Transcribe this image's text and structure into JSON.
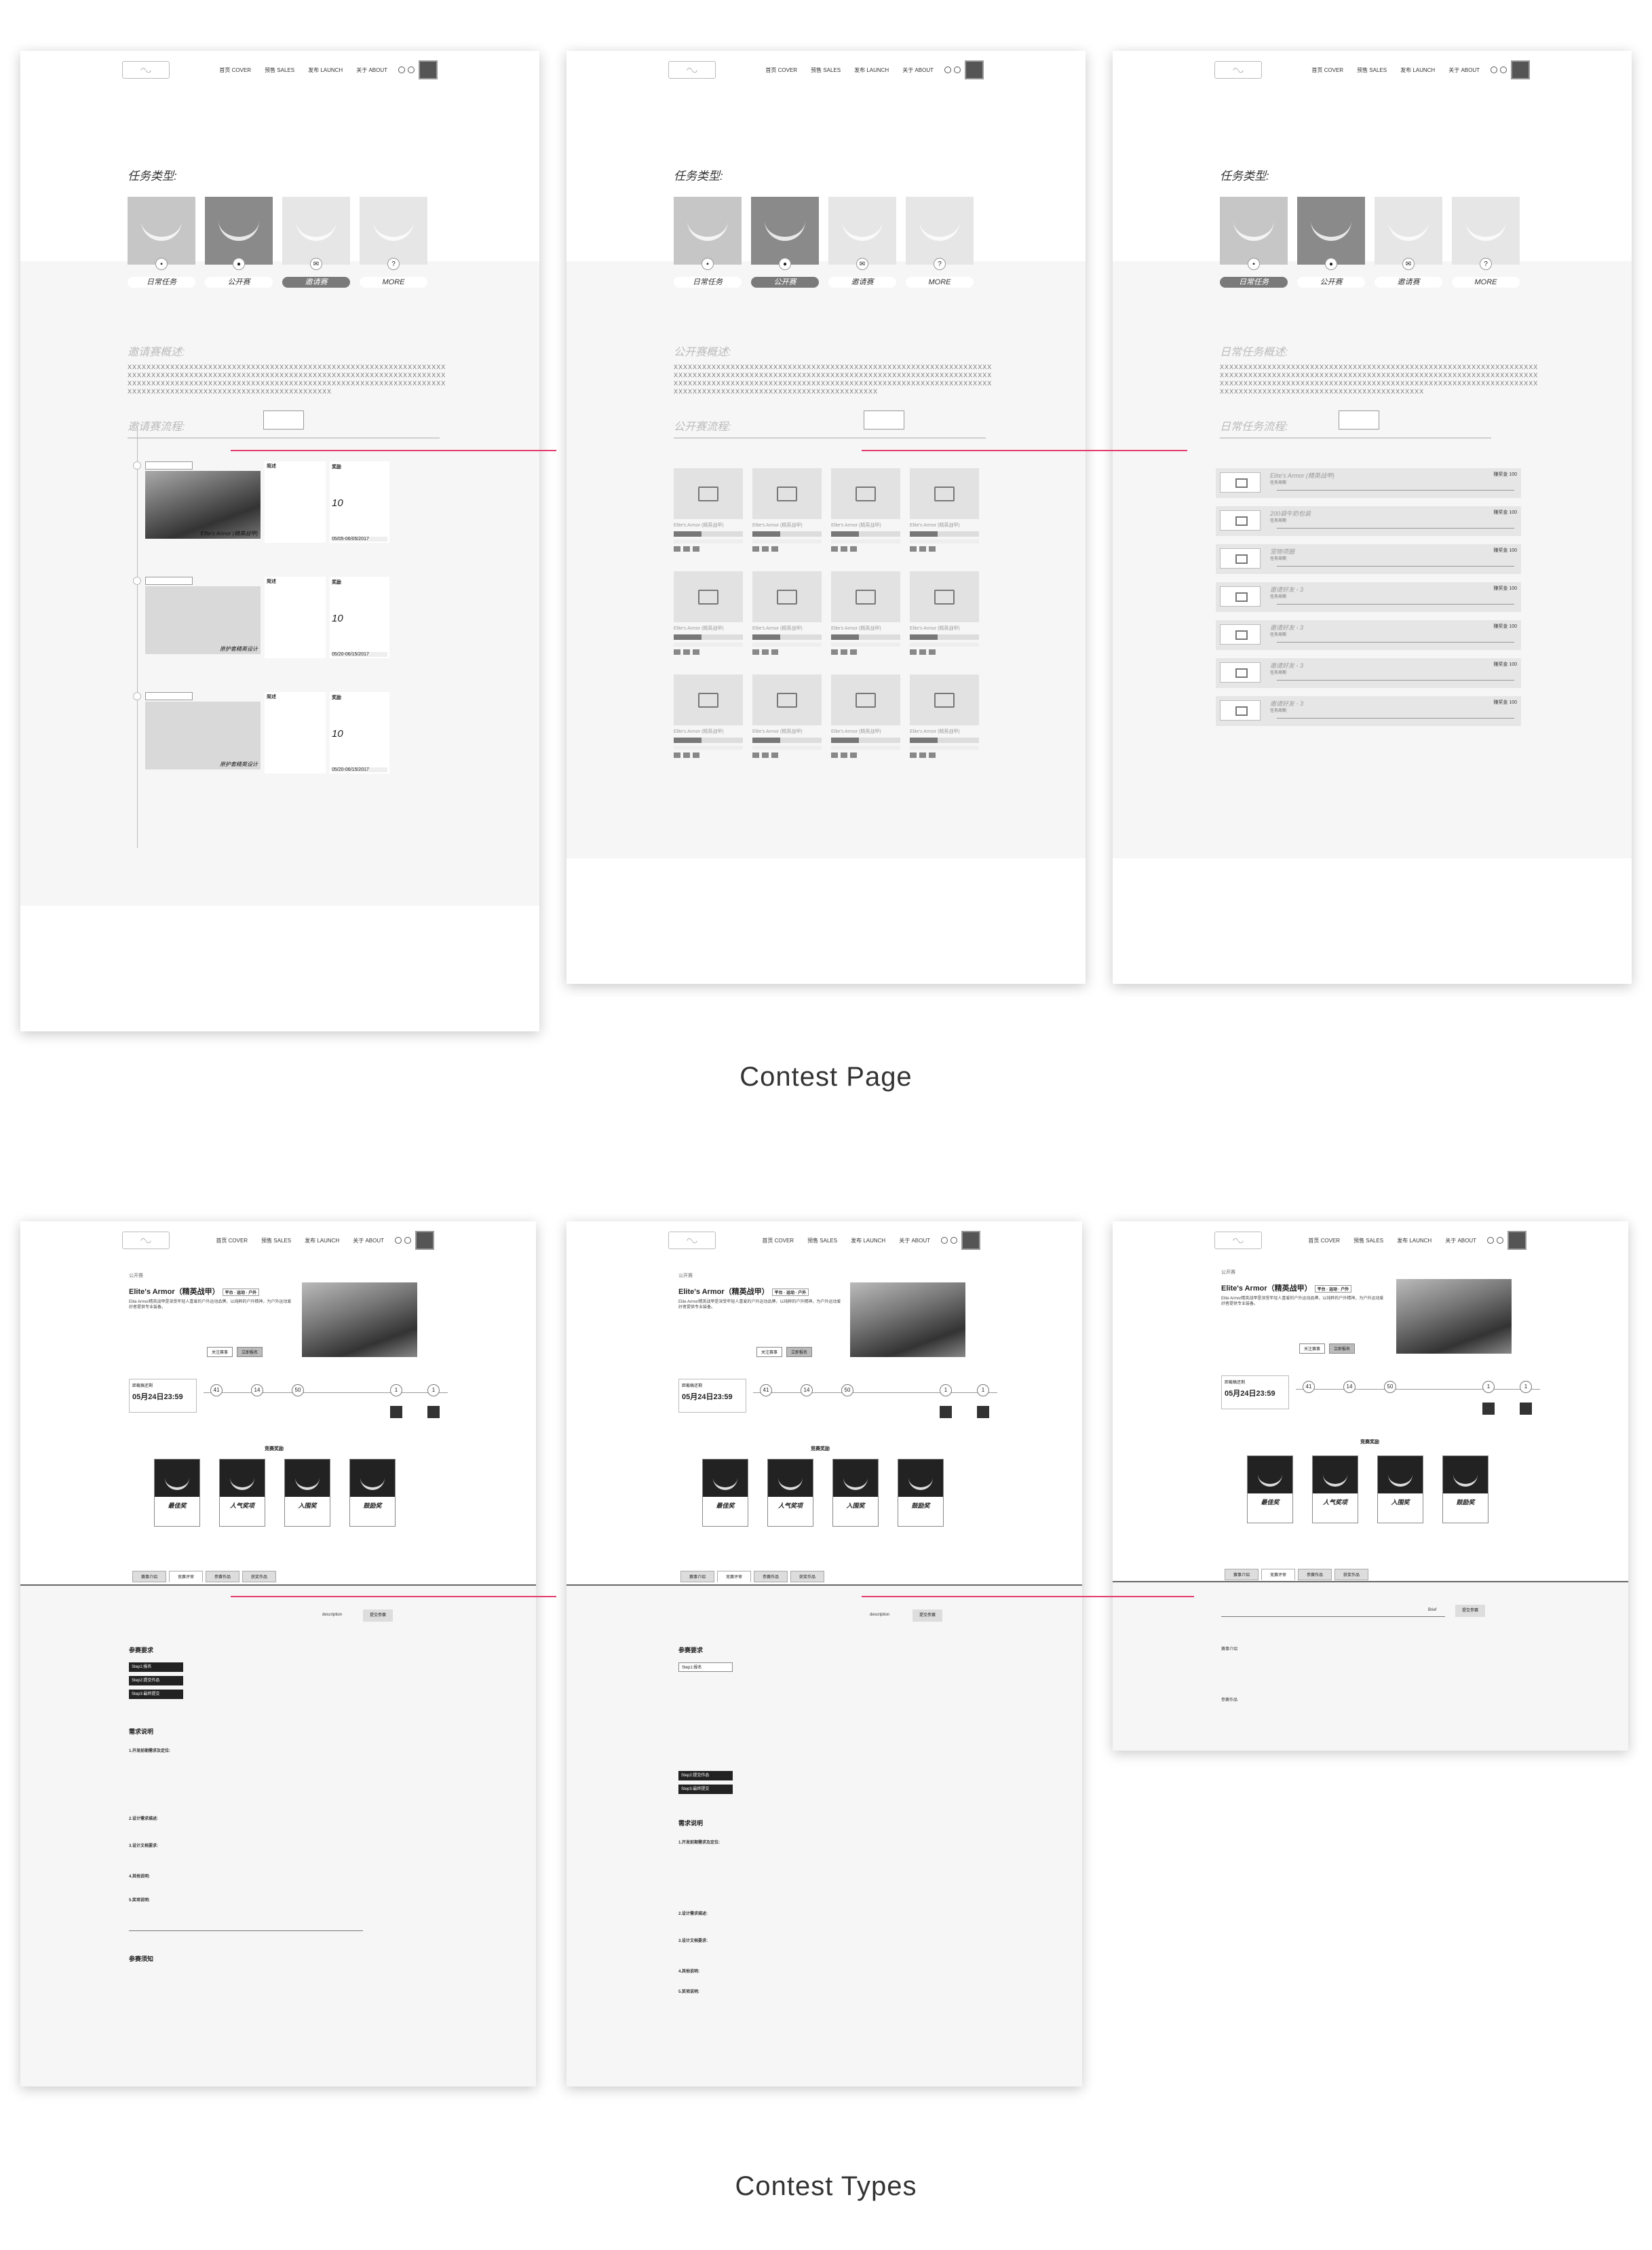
{
  "nav": {
    "links": [
      "首页\nCOVER",
      "预售\nSALES",
      "发布\nLAUNCH",
      "关于\nABOUT"
    ]
  },
  "contest": {
    "section_title": "任务类型:",
    "types": [
      "日常任务",
      "公开赛",
      "邀请赛",
      "MORE"
    ],
    "overview_invite": "邀请赛概述:",
    "overview_public": "公开赛概述:",
    "overview_daily": "日常任务概述:",
    "flow_invite": "邀请赛流程:",
    "flow_public": "公开赛流程:",
    "flow_daily": "日常任务流程:",
    "xtext": "XXXXXXXXXXXXXXXXXXXXXXXXXXXXXXXXXXXXXXXXXXXXXXXXXXXXXXXXXXXXXXXXXXXXXXXXXXXXXXXXXXXXXXXXXXXXXXXXXXXXXXXXXXXXXXXXXXXXXXXXXXXXXXXXXXXXXXXXXXXXXXXXXXXXXXXXXXXXXXXXXXXXXXXXXXXXXXXXXXXXXXXXXXXXXXXXXXXXXXXXXXXXXXXXXXXXXXXXXXXXXXXXXXXXXXXXXXXXXXXXXXXX",
    "entry_caption": "Elite's Armor (精英战甲)",
    "entry_caption2": "原护套精英设计",
    "intro": "简述",
    "reward": "奖励",
    "reward_big": "10",
    "date1": "05/05-06/05/2017",
    "date2": "05/20-06/15/2017",
    "grid_name": "Elite's Armor (精英战甲)",
    "row_titles": [
      "Elite's Armor (精英战甲)",
      "200袋牛奶包装",
      "宠物项圈",
      "邀请好友 - 3",
      "邀请好友 - 3",
      "邀请好友 - 3",
      "邀请好友 - 3"
    ],
    "row_sub": "任务周期",
    "row_reward": "赚奖金 100"
  },
  "detail": {
    "crumb": "公开赛",
    "title": "Elite's Armor（精英战甲）",
    "tags": "平台 · 运动 · 户外",
    "desc": "Elite Armor精英战甲是深受年轻人喜爱的户外运动品牌，以纯粹的户外精神，为户外运动爱好者提供专业装备。",
    "btn1": "关注赛事",
    "btn2": "立即报名",
    "count_title": "距截稿还剩",
    "count_value": "05月24日23:59",
    "steps": [
      "41",
      "14",
      "50",
      "1",
      "1"
    ],
    "prizes_title": "竞赛奖励",
    "prizes": [
      "最佳奖",
      "人气奖项",
      "入围奖",
      "鼓励奖"
    ],
    "tabs": [
      "赛事介绍",
      "竞赛评审",
      "参赛作品",
      "获奖作品"
    ],
    "desc_label": "description",
    "join_btn": "提交参赛",
    "req_title": "参赛要求",
    "steps_pills": [
      "Step1:报名",
      "Step2:提交作品",
      "Step3:最终提交"
    ],
    "spec_title": "需求说明",
    "spec_items": [
      "1.开发前期需求及定位:",
      "2.设计需求描述:",
      "3.设计文档要求:",
      "4.其他说明:",
      "5.奖项说明:"
    ],
    "notice_title": "参赛须知",
    "right_label": "Brief"
  },
  "captions": {
    "top": "Contest Page",
    "bottom": "Contest Types"
  }
}
